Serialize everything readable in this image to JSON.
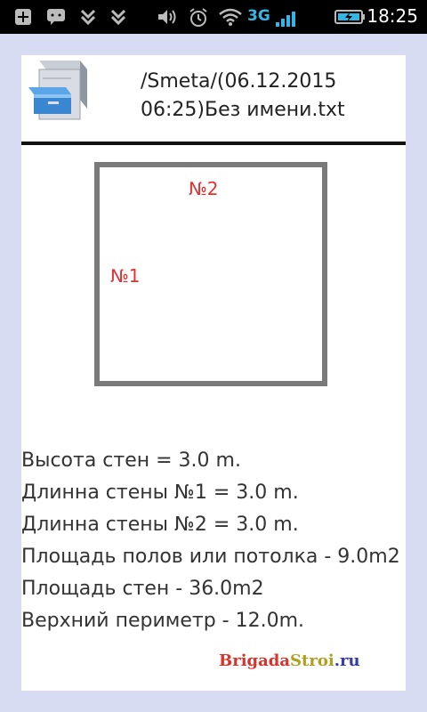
{
  "status_bar": {
    "network": "3G",
    "time": "18:25",
    "icons": [
      "plus-box-icon",
      "chat-icon",
      "download-icon",
      "download-icon",
      "volume-icon",
      "alarm-icon",
      "wifi-icon",
      "signal-icon",
      "battery-charging-icon"
    ]
  },
  "header": {
    "icon": "filing-cabinet-icon",
    "title": "/Smeta/(06.12.2015\n06:25)Без имени.txt"
  },
  "plan": {
    "wall_labels": [
      "№1",
      "№2"
    ],
    "wall_color": "#7a7a7a",
    "label_color": "#e53030"
  },
  "info": {
    "lines": [
      "Высота стен = 3.0 m.",
      "Длинна стены №1 = 3.0 m.",
      "Длинна стены №2 = 3.0 m.",
      "Площадь полов или потолка - 9.0m2",
      "Площадь стен - 36.0m2",
      "Верхний периметр - 12.0m."
    ]
  },
  "watermark": {
    "a": "Brigada",
    "b": "Stroi",
    "c": ".ru"
  },
  "colors": {
    "background": "#d8dcf2",
    "status_bar": "#000000",
    "accent": "#33b5e5"
  }
}
